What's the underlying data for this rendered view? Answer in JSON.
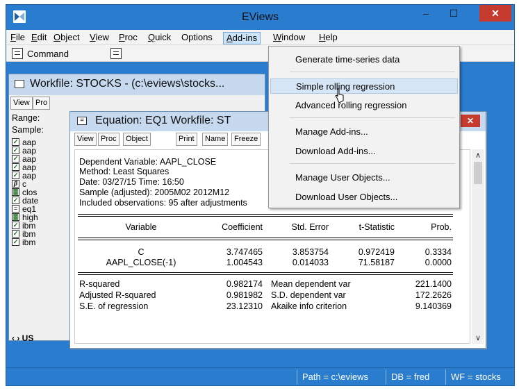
{
  "app": {
    "title": "EViews",
    "window_buttons": {
      "minimize": "‒",
      "maximize": "☐",
      "close": "✕"
    }
  },
  "menubar": [
    {
      "label": "File",
      "accel": "F",
      "rest": "ile"
    },
    {
      "label": "Edit",
      "accel": "E",
      "rest": "dit"
    },
    {
      "label": "Object",
      "accel": "O",
      "rest": "bject"
    },
    {
      "label": "View",
      "accel": "V",
      "rest": "iew"
    },
    {
      "label": "Proc",
      "accel": "P",
      "rest": "roc"
    },
    {
      "label": "Quick",
      "accel": "Q",
      "rest": "uick"
    },
    {
      "label": "Options",
      "accel": "",
      "rest": "Options"
    },
    {
      "label": "Add-ins",
      "accel": "A",
      "rest": "dd-ins"
    },
    {
      "label": "Window",
      "accel": "W",
      "rest": "indow"
    },
    {
      "label": "Help",
      "accel": "H",
      "rest": "elp"
    }
  ],
  "commandbar": {
    "label": "Command"
  },
  "addins_menu": {
    "items": [
      {
        "label": "Generate time-series data"
      },
      {
        "label": "Simple rolling regression"
      },
      {
        "label": "Advanced rolling regression"
      },
      {
        "label": "Manage Add-ins..."
      },
      {
        "label": "Download Add-ins..."
      },
      {
        "label": "Manage User Objects..."
      },
      {
        "label": "Download User Objects..."
      }
    ]
  },
  "workfile": {
    "title": "Workfile: STOCKS - (c:\\eviews\\stocks...",
    "toolbar": [
      "View",
      "Pro"
    ],
    "range_label": "Range:",
    "sample_label": "Sample:",
    "objects": [
      {
        "name": "aap",
        "icon": "series"
      },
      {
        "name": "aap",
        "icon": "series"
      },
      {
        "name": "aap",
        "icon": "series"
      },
      {
        "name": "aap",
        "icon": "series"
      },
      {
        "name": "aap",
        "icon": "series"
      },
      {
        "name": "c",
        "icon": "coef"
      },
      {
        "name": "clos",
        "icon": "group"
      },
      {
        "name": "date",
        "icon": "series"
      },
      {
        "name": "eq1",
        "icon": "equation"
      },
      {
        "name": "high",
        "icon": "group"
      },
      {
        "name": "ibm",
        "icon": "series"
      },
      {
        "name": "ibm",
        "icon": "series"
      },
      {
        "name": "ibm",
        "icon": "series"
      }
    ],
    "tab_label": "US"
  },
  "equation": {
    "title": "Equation: EQ1   Workfile: ST",
    "toolbar": [
      "View",
      "Proc",
      "Object",
      "Print",
      "Name",
      "Freeze"
    ],
    "header": {
      "dependent": "Dependent Variable: AAPL_CLOSE",
      "method": "Method: Least Squares",
      "date": "Date: 03/27/15   Time: 16:50",
      "sample": "Sample (adjusted): 2005M02 2012M12",
      "observations": "Included observations: 95 after adjustments"
    },
    "columns": [
      "Variable",
      "Coefficient",
      "Std. Error",
      "t-Statistic",
      "Prob."
    ],
    "rows": [
      {
        "variable": "C",
        "coefficient": "3.747465",
        "std_error": "3.853754",
        "t_stat": "0.972419",
        "prob": "0.3334"
      },
      {
        "variable": "AAPL_CLOSE(-1)",
        "coefficient": "1.004543",
        "std_error": "0.014033",
        "t_stat": "71.58187",
        "prob": "0.0000"
      }
    ],
    "stats": [
      {
        "label": "R-squared",
        "value": "0.982174",
        "label2": "Mean dependent var",
        "value2": "221.1400"
      },
      {
        "label": "Adjusted R-squared",
        "value": "0.981982",
        "label2": "S.D. dependent var",
        "value2": "172.2626"
      },
      {
        "label": "S.E. of regression",
        "value": "23.12310",
        "label2": "Akaike info criterion",
        "value2": "9.140369"
      }
    ]
  },
  "statusbar": {
    "path": "Path = c:\\eviews",
    "db": "DB = fred",
    "wf": "WF = stocks"
  },
  "colors": {
    "frame": "#2a7ccf",
    "close_red": "#c73a2e",
    "menu_hover": "#d7e6f7"
  }
}
